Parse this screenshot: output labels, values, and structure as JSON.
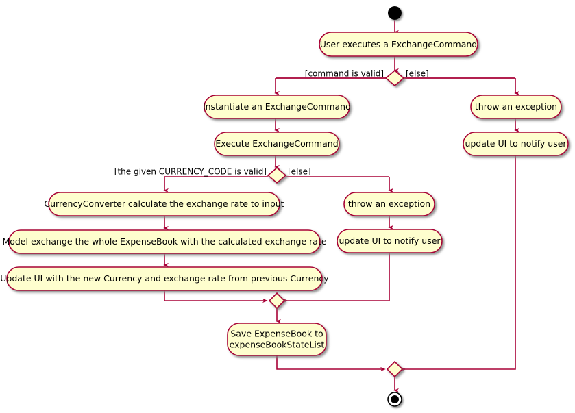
{
  "diagram": {
    "type": "activity-diagram",
    "title": "",
    "colors": {
      "node_fill": "#FEFECE",
      "node_stroke": "#A80036",
      "arrow": "#A80036",
      "text": "#000000",
      "background": "#FFFFFF",
      "terminal_fill": "#000000",
      "shadow": "#808080"
    },
    "start_node": {
      "label": "start"
    },
    "end_node": {
      "label": "stop"
    },
    "activities": [
      {
        "id": "a1",
        "label": "User executes a ExchangeCommand"
      },
      {
        "id": "a2",
        "label": "Instantiate an ExchangeCommand"
      },
      {
        "id": "a3",
        "label": "Execute ExchangeCommand"
      },
      {
        "id": "a4",
        "label": "CurrencyConverter calculate the exchange rate to input"
      },
      {
        "id": "a5",
        "label": "Model exchange the whole ExpenseBook with the calculated exchange rate"
      },
      {
        "id": "a6",
        "label": "Update UI with the new Currency and exchange rate from previous Currency"
      },
      {
        "id": "a7",
        "label": "throw an exception"
      },
      {
        "id": "a8",
        "label": "update UI to notify user"
      },
      {
        "id": "a9",
        "label": "throw an exception"
      },
      {
        "id": "a10",
        "label": "update UI to notify user"
      },
      {
        "id": "a11",
        "line1": "Save ExpenseBook to",
        "line2": "expenseBookStateList"
      }
    ],
    "decisions": [
      {
        "id": "d1",
        "yes_label": "[command is valid]",
        "no_label": "[else]"
      },
      {
        "id": "d2",
        "yes_label": "[the given CURRENCY_CODE is valid]",
        "no_label": "[else]"
      }
    ],
    "merges": [
      {
        "id": "m1"
      },
      {
        "id": "m2"
      }
    ]
  }
}
